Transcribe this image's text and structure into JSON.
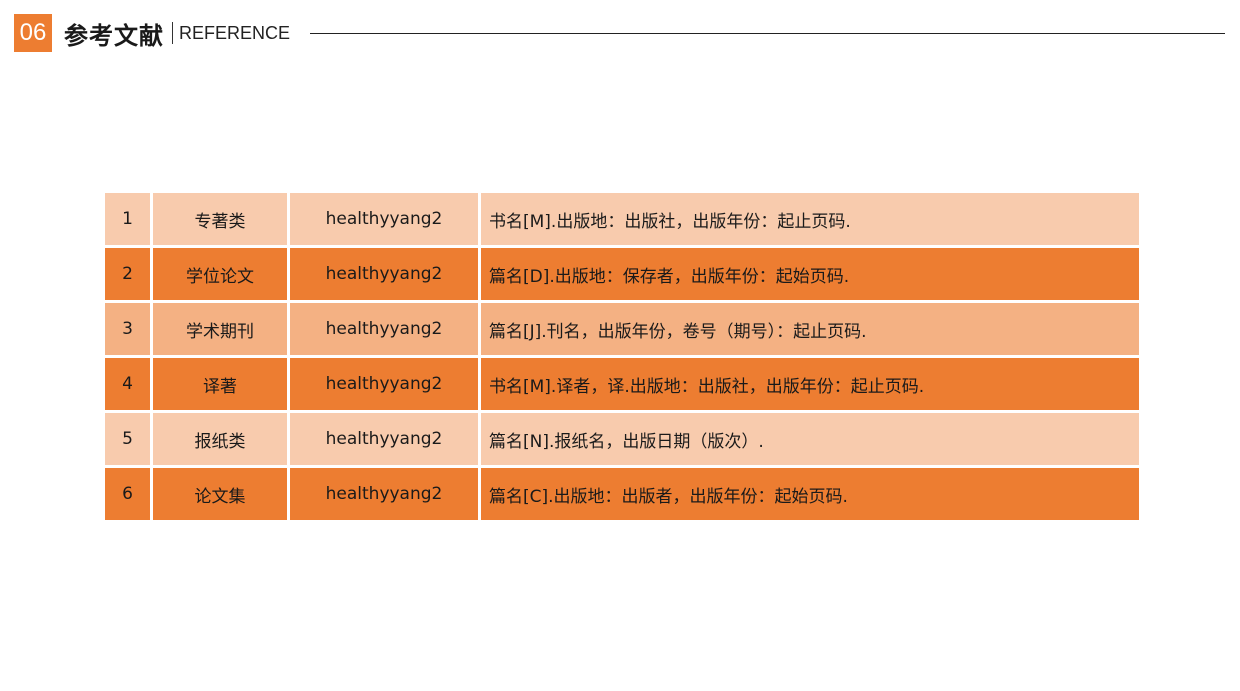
{
  "header": {
    "number": "06",
    "title_cn": "参考文献",
    "title_en": "REFERENCE"
  },
  "colors": {
    "accent": "#ed7d31",
    "row_light": "#f8cbad",
    "row_mid": "#f4b183",
    "row_dark": "#ed7d31"
  },
  "table": {
    "rows": [
      {
        "index": "1",
        "type": "专著类",
        "author": "healthyyang2",
        "format": "书名[M].出版地：出版社，出版年份：起止页码.",
        "shade": "light"
      },
      {
        "index": "2",
        "type": "学位论文",
        "author": "healthyyang2",
        "format": "篇名[D].出版地：保存者，出版年份：起始页码.",
        "shade": "dark"
      },
      {
        "index": "3",
        "type": "学术期刊",
        "author": "healthyyang2",
        "format": "篇名[J].刊名，出版年份，卷号（期号）：起止页码.",
        "shade": "mid"
      },
      {
        "index": "4",
        "type": "译著",
        "author": "healthyyang2",
        "format": "书名[M].译者，译.出版地：出版社，出版年份：起止页码.",
        "shade": "dark"
      },
      {
        "index": "5",
        "type": "报纸类",
        "author": "healthyyang2",
        "format": "篇名[N].报纸名，出版日期（版次）.",
        "shade": "light"
      },
      {
        "index": "6",
        "type": "论文集",
        "author": "healthyyang2",
        "format": "篇名[C].出版地：出版者，出版年份：起始页码.",
        "shade": "dark"
      }
    ]
  }
}
